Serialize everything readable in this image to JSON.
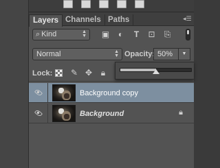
{
  "panel": {
    "tabs": [
      {
        "label": "Layers",
        "active": true
      },
      {
        "label": "Channels",
        "active": false
      },
      {
        "label": "Paths",
        "active": false
      }
    ]
  },
  "filter": {
    "kind_label": "Kind",
    "icons": [
      "image-filter-icon",
      "adjustment-filter-icon",
      "type-filter-icon",
      "shape-filter-icon",
      "smart-object-filter-icon"
    ]
  },
  "blend": {
    "mode": "Normal",
    "opacity_label": "Opacity:",
    "opacity_value": "50%",
    "opacity_fraction": 0.5
  },
  "lock": {
    "label": "Lock:"
  },
  "layers": [
    {
      "name": "Background copy",
      "selected": true,
      "italic": false,
      "locked": false
    },
    {
      "name": "Background",
      "selected": false,
      "italic": true,
      "locked": true
    }
  ],
  "colors": {
    "panel_bg": "#535353",
    "selection": "#7d8fa0"
  }
}
